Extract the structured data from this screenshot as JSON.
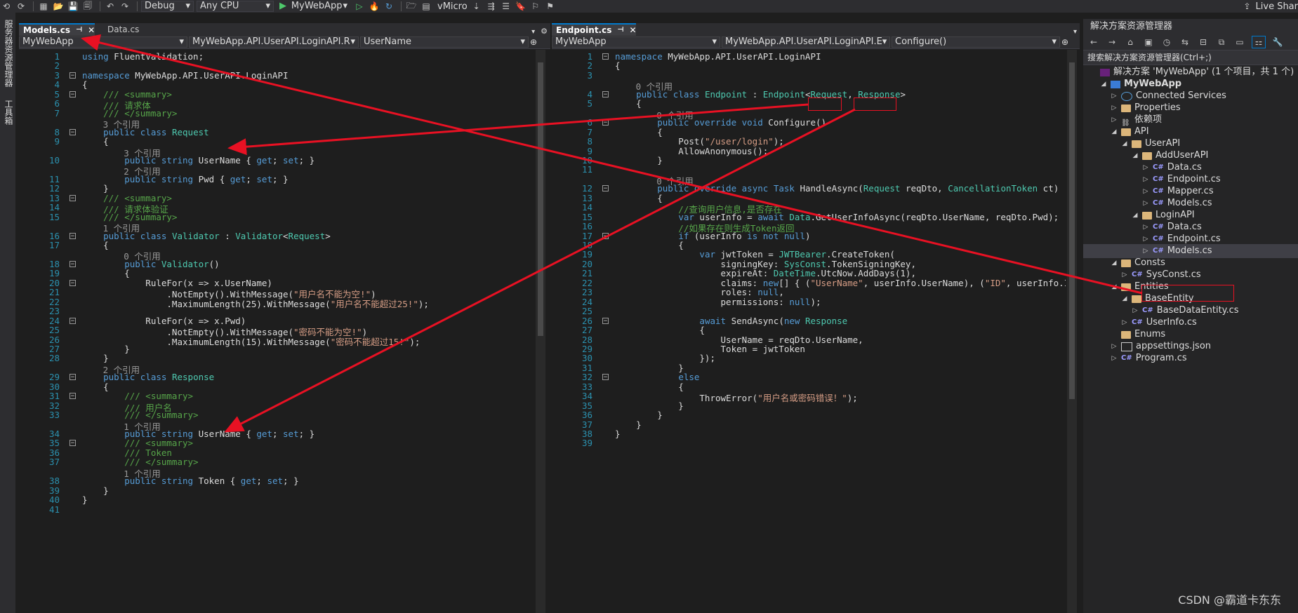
{
  "toolbar": {
    "config": "Debug",
    "platform": "Any CPU",
    "run_target": "MyWebApp",
    "vmicro": "vMicro",
    "live_share": "Live Shar"
  },
  "left_strip": {
    "tab1": "服务器资源管理器",
    "tab2": "工具箱"
  },
  "left_editor": {
    "tabs": [
      {
        "label": "Models.cs",
        "active": true
      },
      {
        "label": "Data.cs",
        "active": false
      }
    ],
    "nav": {
      "project": "MyWebApp",
      "class": "MyWebApp.API.UserAPI.LoginAPI.R",
      "member": "UserName"
    },
    "lines": [
      "using FluentValidation;",
      "",
      "namespace MyWebApp.API.UserAPI.LoginAPI",
      "{",
      "    /// <summary>",
      "    /// 请求体",
      "    /// </summary>",
      "    public class Request",
      "    {",
      "        public string UserName { get; set; }",
      "        public string Pwd { get; set; }",
      "    }",
      "    /// <summary>",
      "    /// 请求体验证",
      "    /// </summary>",
      "    public class Validator : Validator<Request>",
      "    {",
      "        public Validator()",
      "        {",
      "            RuleFor(x => x.UserName)",
      "                .NotEmpty().WithMessage(\"用户名不能为空!\")",
      "                .MaximumLength(25).WithMessage(\"用户名不能超过25!\");",
      "",
      "            RuleFor(x => x.Pwd)",
      "                .NotEmpty().WithMessage(\"密码不能为空!\")",
      "                .MaximumLength(15).WithMessage(\"密码不能超过15!\");",
      "        }",
      "    }",
      "    public class Response",
      "    {",
      "        /// <summary>",
      "        /// 用户名",
      "        /// </summary>",
      "        public string UserName { get; set; }",
      "        /// <summary>",
      "        /// Token",
      "        /// </summary>",
      "        public string Token { get; set; }",
      "    }",
      "}",
      ""
    ],
    "refs": [
      {
        "before": 8,
        "text": "3 个引用"
      },
      {
        "before": 10,
        "text": "3 个引用"
      },
      {
        "before": 11,
        "text": "2 个引用"
      },
      {
        "before": 16,
        "text": "1 个引用"
      },
      {
        "before": 18,
        "text": "0 个引用"
      },
      {
        "before": 29,
        "text": "2 个引用"
      },
      {
        "before": 34,
        "text": "1 个引用"
      },
      {
        "before": 38,
        "text": "1 个引用"
      }
    ]
  },
  "right_editor": {
    "tabs": [
      {
        "label": "Endpoint.cs",
        "active": true
      }
    ],
    "nav": {
      "project": "MyWebApp",
      "class": "MyWebApp.API.UserAPI.LoginAPI.E",
      "member": "Configure()"
    },
    "lines": [
      "namespace MyWebApp.API.UserAPI.LoginAPI",
      "{",
      "",
      "    public class Endpoint : Endpoint<Request, Response>",
      "    {",
      "        public override void Configure()",
      "        {",
      "            Post(\"/user/login\");",
      "            AllowAnonymous();",
      "        }",
      "",
      "        public override async Task HandleAsync(Request reqDto, CancellationToken ct)",
      "        {",
      "            //查询用户信息,是否存在",
      "            var userInfo = await Data.GetUserInfoAsync(reqDto.UserName, reqDto.Pwd);",
      "            //如果存在则生成Token返回",
      "            if (userInfo is not null)",
      "            {",
      "                var jwtToken = JWTBearer.CreateToken(",
      "                    signingKey: SysConst.TokenSigningKey,",
      "                    expireAt: DateTime.UtcNow.AddDays(1),",
      "                    claims: new[] { (\"UserName\", userInfo.UserName), (\"ID\", userInfo.ID)",
      "                    roles: null,",
      "                    permissions: null);",
      "",
      "                await SendAsync(new Response",
      "                {",
      "                    UserName = reqDto.UserName,",
      "                    Token = jwtToken",
      "                });",
      "            }",
      "            else",
      "            {",
      "                ThrowError(\"用户名或密码错误！\");",
      "            }",
      "        }",
      "    }",
      "}",
      ""
    ],
    "refs": [
      {
        "before": 4,
        "text": "0 个引用"
      },
      {
        "before": 6,
        "text": "0 个引用"
      },
      {
        "before": 12,
        "text": "0 个引用"
      }
    ]
  },
  "solution_explorer": {
    "title": "解决方案资源管理器",
    "search": "搜索解决方案资源管理器(Ctrl+;)",
    "items": [
      {
        "label": "解决方案 'MyWebApp' (1 个项目，共 1 个)",
        "depth": 0,
        "kind": "solution",
        "arrow": ""
      },
      {
        "label": "MyWebApp",
        "depth": 1,
        "kind": "project",
        "arrow": "down"
      },
      {
        "label": "Connected Services",
        "depth": 2,
        "kind": "service",
        "arrow": "right"
      },
      {
        "label": "Properties",
        "depth": 2,
        "kind": "folder",
        "arrow": "right"
      },
      {
        "label": "依赖项",
        "depth": 2,
        "kind": "deps",
        "arrow": "right"
      },
      {
        "label": "API",
        "depth": 2,
        "kind": "folder",
        "arrow": "down"
      },
      {
        "label": "UserAPI",
        "depth": 3,
        "kind": "folder",
        "arrow": "down"
      },
      {
        "label": "AddUserAPI",
        "depth": 4,
        "kind": "folder",
        "arrow": "down"
      },
      {
        "label": "Data.cs",
        "depth": 5,
        "kind": "cs",
        "arrow": "right"
      },
      {
        "label": "Endpoint.cs",
        "depth": 5,
        "kind": "cs",
        "arrow": "right"
      },
      {
        "label": "Mapper.cs",
        "depth": 5,
        "kind": "cs",
        "arrow": "right"
      },
      {
        "label": "Models.cs",
        "depth": 5,
        "kind": "cs",
        "arrow": "right"
      },
      {
        "label": "LoginAPI",
        "depth": 4,
        "kind": "folder",
        "arrow": "down"
      },
      {
        "label": "Data.cs",
        "depth": 5,
        "kind": "cs",
        "arrow": "right"
      },
      {
        "label": "Endpoint.cs",
        "depth": 5,
        "kind": "cs",
        "arrow": "right"
      },
      {
        "label": "Models.cs",
        "depth": 5,
        "kind": "cs",
        "arrow": "right",
        "selected": true
      },
      {
        "label": "Consts",
        "depth": 2,
        "kind": "folder",
        "arrow": "down"
      },
      {
        "label": "SysConst.cs",
        "depth": 3,
        "kind": "cs",
        "arrow": "right"
      },
      {
        "label": "Entities",
        "depth": 2,
        "kind": "folder",
        "arrow": "down"
      },
      {
        "label": "BaseEntity",
        "depth": 3,
        "kind": "folder",
        "arrow": "down"
      },
      {
        "label": "BaseDataEntity.cs",
        "depth": 4,
        "kind": "cs",
        "arrow": "right"
      },
      {
        "label": "UserInfo.cs",
        "depth": 3,
        "kind": "cs",
        "arrow": "right"
      },
      {
        "label": "Enums",
        "depth": 2,
        "kind": "folder",
        "arrow": ""
      },
      {
        "label": "appsettings.json",
        "depth": 2,
        "kind": "json",
        "arrow": "right"
      },
      {
        "label": "Program.cs",
        "depth": 2,
        "kind": "cs",
        "arrow": "right"
      }
    ]
  },
  "watermark": "CSDN @霸道卡东东",
  "colors": {
    "accent": "#007acc",
    "annotation_red": "#e81123",
    "keyword": "#569cd6",
    "type": "#4ec9b0",
    "string": "#d69d85",
    "comment": "#57a64a"
  }
}
